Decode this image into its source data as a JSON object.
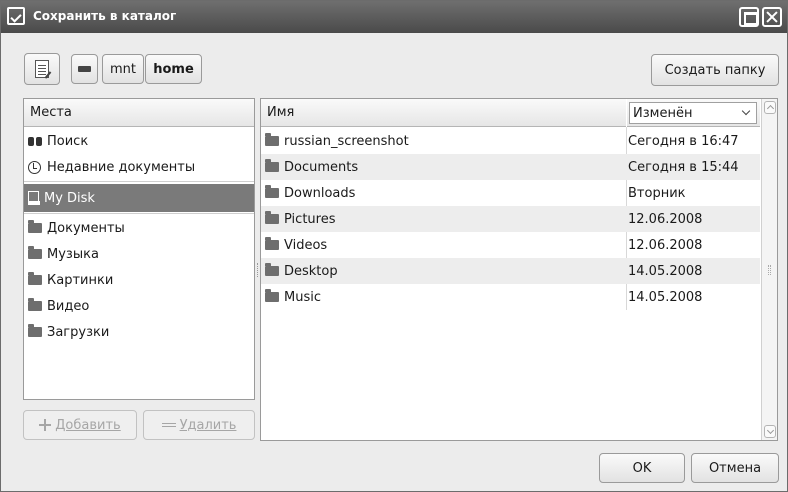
{
  "window": {
    "title": "Сохранить в каталог"
  },
  "toolbar": {
    "path_segments": [
      "mnt",
      "home"
    ],
    "create_folder_label": "Создать папку"
  },
  "places": {
    "header": "Места",
    "items": [
      {
        "label": "Поиск",
        "icon": "search-icon"
      },
      {
        "label": "Недавние документы",
        "icon": "recent-icon"
      },
      {
        "label": "My Disk",
        "icon": "disk-icon",
        "selected": true
      },
      {
        "label": "Документы",
        "icon": "folder-icon"
      },
      {
        "label": "Музыка",
        "icon": "folder-icon"
      },
      {
        "label": "Картинки",
        "icon": "folder-icon"
      },
      {
        "label": "Видео",
        "icon": "folder-icon"
      },
      {
        "label": "Загрузки",
        "icon": "folder-icon"
      }
    ],
    "add_label": "Добавить",
    "remove_label": "Удалить"
  },
  "files": {
    "name_header": "Имя",
    "date_header": "Изменён",
    "rows": [
      {
        "name": "russian_screenshot",
        "modified": "Сегодня в 16:47"
      },
      {
        "name": "Documents",
        "modified": "Сегодня в 15:44"
      },
      {
        "name": "Downloads",
        "modified": "Вторник"
      },
      {
        "name": "Pictures",
        "modified": "12.06.2008"
      },
      {
        "name": "Videos",
        "modified": "12.06.2008"
      },
      {
        "name": "Desktop",
        "modified": "14.05.2008"
      },
      {
        "name": "Music",
        "modified": "14.05.2008"
      }
    ]
  },
  "footer": {
    "ok_label": "OK",
    "cancel_label": "Отмена"
  },
  "colors": {
    "titlebar": "#5a5a5a",
    "selection": "#7a7a7a",
    "alt_row": "#ededed"
  }
}
